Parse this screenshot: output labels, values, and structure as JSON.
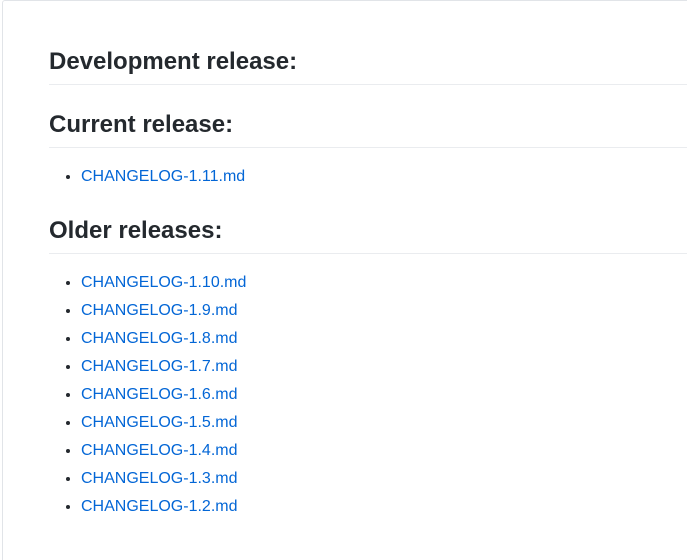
{
  "development": {
    "heading": "Development release:"
  },
  "current": {
    "heading": "Current release:",
    "items": [
      "CHANGELOG-1.11.md"
    ]
  },
  "older": {
    "heading": "Older releases:",
    "items": [
      "CHANGELOG-1.10.md",
      "CHANGELOG-1.9.md",
      "CHANGELOG-1.8.md",
      "CHANGELOG-1.7.md",
      "CHANGELOG-1.6.md",
      "CHANGELOG-1.5.md",
      "CHANGELOG-1.4.md",
      "CHANGELOG-1.3.md",
      "CHANGELOG-1.2.md"
    ]
  },
  "colors": {
    "link": "#0366d6",
    "text": "#24292e",
    "divider": "#eaecef"
  }
}
